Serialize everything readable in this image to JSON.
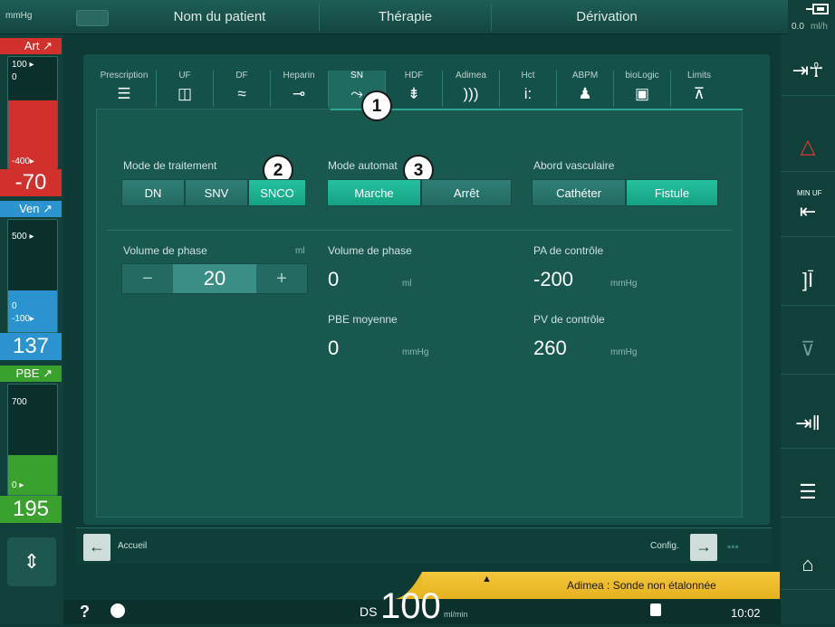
{
  "topbar": {
    "unit_label": "mmHg",
    "tabs": [
      {
        "label": "Nom du patient"
      },
      {
        "label": "Thérapie"
      },
      {
        "label": "Dérivation"
      }
    ],
    "uf_rate": {
      "value": "0.0",
      "unit": "ml/h"
    }
  },
  "pressures": {
    "art": {
      "label": "Art",
      "scale_top": "100",
      "scale_zero": "0",
      "scale_bottom": "-400",
      "value": "-70",
      "color": "#d1302d"
    },
    "ven": {
      "label": "Ven",
      "scale_top": "500",
      "scale_zero": "0",
      "scale_bottom": "-100",
      "value": "137",
      "color": "#2a93d0"
    },
    "pbe": {
      "label": "PBE",
      "scale_top": "700",
      "scale_bottom": "0",
      "value": "195",
      "color": "#3aa12f"
    }
  },
  "subtabs": [
    {
      "label": "Prescription",
      "icon": "sliders-icon"
    },
    {
      "label": "UF",
      "icon": "uf-icon"
    },
    {
      "label": "DF",
      "icon": "wave-icon"
    },
    {
      "label": "Heparin",
      "icon": "syringe-icon"
    },
    {
      "label": "SN",
      "icon": "single-needle-icon"
    },
    {
      "label": "HDF",
      "icon": "hdf-icon"
    },
    {
      "label": "Adimea",
      "icon": "signal-icon"
    },
    {
      "label": "Hct",
      "icon": "hct-icon"
    },
    {
      "label": "ABPM",
      "icon": "person-icon"
    },
    {
      "label": "bioLogic",
      "icon": "biologic-icon"
    },
    {
      "label": "Limits",
      "icon": "limits-icon"
    }
  ],
  "callouts": [
    "1",
    "2",
    "3"
  ],
  "mode_traitement": {
    "label": "Mode de traitement",
    "options": [
      "DN",
      "SNV",
      "SNCO"
    ],
    "selected": "SNCO"
  },
  "mode_automatique": {
    "label": "Mode automat",
    "options": [
      "Marche",
      "Arrêt"
    ],
    "selected": "Marche"
  },
  "abord": {
    "label": "Abord vasculaire",
    "options": [
      "Cathéter",
      "Fistule"
    ],
    "selected": "Fistule"
  },
  "volume_phase_input": {
    "label": "Volume de phase",
    "unit": "ml",
    "value": "20",
    "minus": "−",
    "plus": "+"
  },
  "volume_phase": {
    "label": "Volume de phase",
    "value": "0",
    "unit": "ml"
  },
  "pbe_moyenne": {
    "label": "PBE moyenne",
    "value": "0",
    "unit": "mmHg"
  },
  "pa_controle": {
    "label": "PA de contrôle",
    "value": "-200",
    "unit": "mmHg"
  },
  "pv_controle": {
    "label": "PV de contrôle",
    "value": "260",
    "unit": "mmHg"
  },
  "nav": {
    "home_label": "Accueil",
    "config_label": "Config."
  },
  "alarm": {
    "text": "Adimea : Sonde non étalonnée",
    "color": "#f1c232"
  },
  "status": {
    "help": "?",
    "ds_label": "DS",
    "ds_value": "100",
    "ds_unit": "ml/min",
    "time": "10:02"
  },
  "right_buttons": [
    {
      "name": "patient-connect-icon"
    },
    {
      "name": "alarm-triangle-icon"
    },
    {
      "name": "min-uf-icon",
      "label": "MIN UF"
    },
    {
      "name": "bracket-icon"
    },
    {
      "name": "filter-icon"
    },
    {
      "name": "pause-icon"
    },
    {
      "name": "menu-list-icon"
    },
    {
      "name": "home-icon"
    }
  ]
}
